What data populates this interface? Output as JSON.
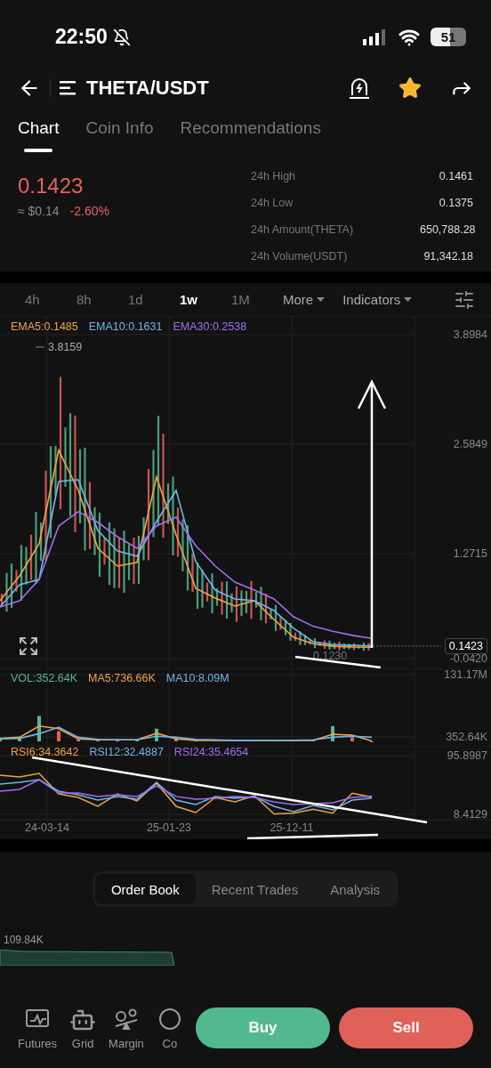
{
  "status_bar": {
    "time": "22:50",
    "battery": "51"
  },
  "header": {
    "title": "THETA/USDT",
    "favorite": true
  },
  "tabs": [
    {
      "label": "Chart",
      "selected": true
    },
    {
      "label": "Coin Info",
      "selected": false
    },
    {
      "label": "Recommendations",
      "selected": false
    }
  ],
  "ticker": {
    "price": "0.1423",
    "fiat": "≈ $0.14",
    "change": "-2.60%",
    "stats": [
      {
        "label": "24h High",
        "value": "0.1461"
      },
      {
        "label": "24h Low",
        "value": "0.1375"
      },
      {
        "label": "24h Amount(THETA)",
        "value": "650,788.28"
      },
      {
        "label": "24h Volume(USDT)",
        "value": "91,342.18"
      }
    ]
  },
  "timeframes": [
    {
      "label": "4h",
      "selected": false
    },
    {
      "label": "8h",
      "selected": false
    },
    {
      "label": "1d",
      "selected": false
    },
    {
      "label": "1w",
      "selected": true
    },
    {
      "label": "1M",
      "selected": false
    }
  ],
  "menus": [
    {
      "label": "More"
    },
    {
      "label": "Indicators"
    }
  ],
  "price_chart": {
    "legend": [
      {
        "text": "EMA5:0.1485",
        "color": "#f0a34a"
      },
      {
        "text": "EMA10:0.1631",
        "color": "#6cb6e8"
      },
      {
        "text": "EMA30:0.2538",
        "color": "#a26ef0"
      }
    ],
    "y_axis": [
      "3.8984",
      "2.5849",
      "1.2715",
      "-0.0420"
    ],
    "peak_label": "3.8159",
    "low_label": "0.1230",
    "last_price": "0.1423"
  },
  "volume_chart": {
    "legend": [
      {
        "text": "VOL:352.64K",
        "color": "#52b98e"
      },
      {
        "text": "MA5:736.66K",
        "color": "#f0a34a"
      },
      {
        "text": "MA10:8.09M",
        "color": "#6cb6e8"
      }
    ],
    "y_axis": [
      "131.17M",
      "352.64K"
    ]
  },
  "rsi_chart": {
    "legend": [
      {
        "text": "RSI6:34.3642",
        "color": "#f0a34a"
      },
      {
        "text": "RSI12:32.4887",
        "color": "#6cb6e8"
      },
      {
        "text": "RSI24:35.4654",
        "color": "#a26ef0"
      }
    ],
    "y_axis": [
      "95.8987",
      "8.4129"
    ],
    "dates": [
      "24-03-14",
      "25-01-23",
      "25-12-11"
    ]
  },
  "bottom_tabs": [
    {
      "label": "Order Book",
      "selected": true
    },
    {
      "label": "Recent Trades",
      "selected": false
    },
    {
      "label": "Analysis",
      "selected": false
    }
  ],
  "depth": {
    "label": "109.84K"
  },
  "nav": [
    {
      "label": "Futures",
      "kind": "futures"
    },
    {
      "label": "Grid",
      "kind": "grid"
    },
    {
      "label": "Margin",
      "kind": "margin"
    },
    {
      "label": "Co",
      "kind": "coin"
    }
  ],
  "buttons": {
    "buy": "Buy",
    "sell": "Sell"
  }
}
